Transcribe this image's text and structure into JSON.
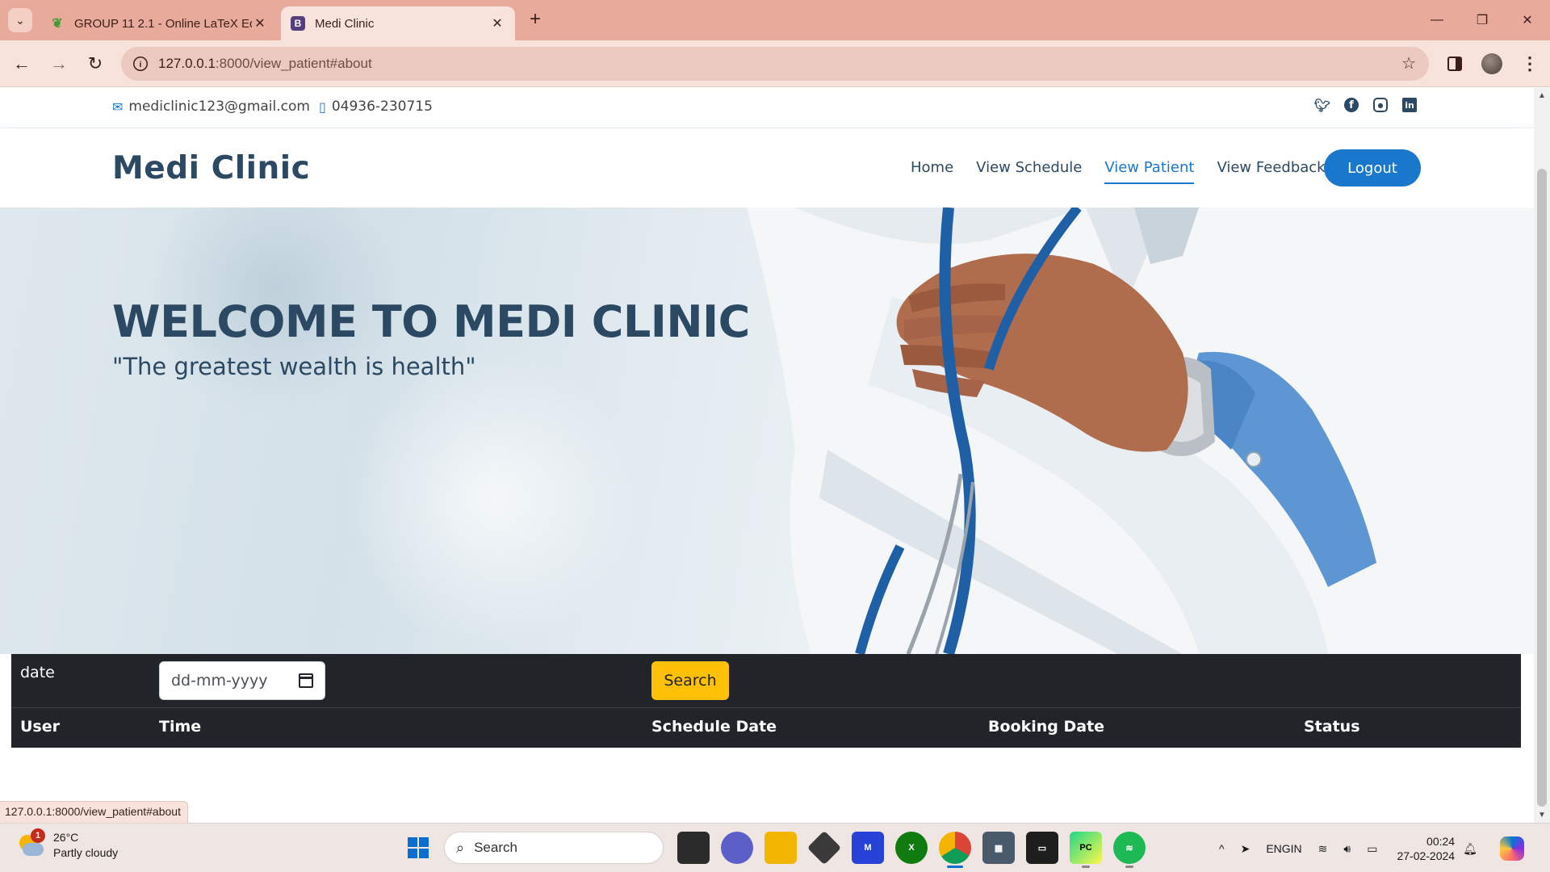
{
  "browser": {
    "tabs": [
      {
        "title": "GROUP 11 2.1 - Online LaTeX Ed",
        "favicon": "overleaf-leaf-icon",
        "active": false
      },
      {
        "title": "Medi Clinic",
        "favicon": "bootstrap-b-icon",
        "active": true
      }
    ],
    "url_host": "127.0.0.1",
    "url_path": ":8000/view_patient#about",
    "status_url": "127.0.0.1:8000/view_patient#about"
  },
  "topbar": {
    "email": "mediclinic123@gmail.com",
    "phone": "04936-230715",
    "socials": [
      "twitter-icon",
      "facebook-icon",
      "instagram-icon",
      "linkedin-icon"
    ]
  },
  "header": {
    "logo": "Medi Clinic",
    "nav": [
      {
        "label": "Home",
        "active": false
      },
      {
        "label": "View Schedule",
        "active": false
      },
      {
        "label": "View Patient",
        "active": true
      },
      {
        "label": "View Feedback",
        "active": false
      }
    ],
    "logout_label": "Logout"
  },
  "hero": {
    "title": "WELCOME TO MEDI CLINIC",
    "subtitle": "\"The greatest wealth is health\""
  },
  "filter": {
    "date_label": "date",
    "date_placeholder": "dd-mm-yyyy",
    "search_label": "Search"
  },
  "table": {
    "columns": [
      "User",
      "Time",
      "Schedule Date",
      "Booking Date",
      "Status"
    ],
    "rows": []
  },
  "taskbar": {
    "weather": {
      "temp": "26°C",
      "condition": "Partly cloudy",
      "badge": "1"
    },
    "search_placeholder": "Search",
    "lang_line1": "ENG",
    "lang_line2": "IN",
    "time": "00:24",
    "date": "27-02-2024"
  },
  "colors": {
    "brand_primary": "#1977cc",
    "heading": "#2c4964",
    "table_dark": "#212529",
    "search_button": "#ffc107",
    "browser_frame": "#e8aa9b"
  }
}
